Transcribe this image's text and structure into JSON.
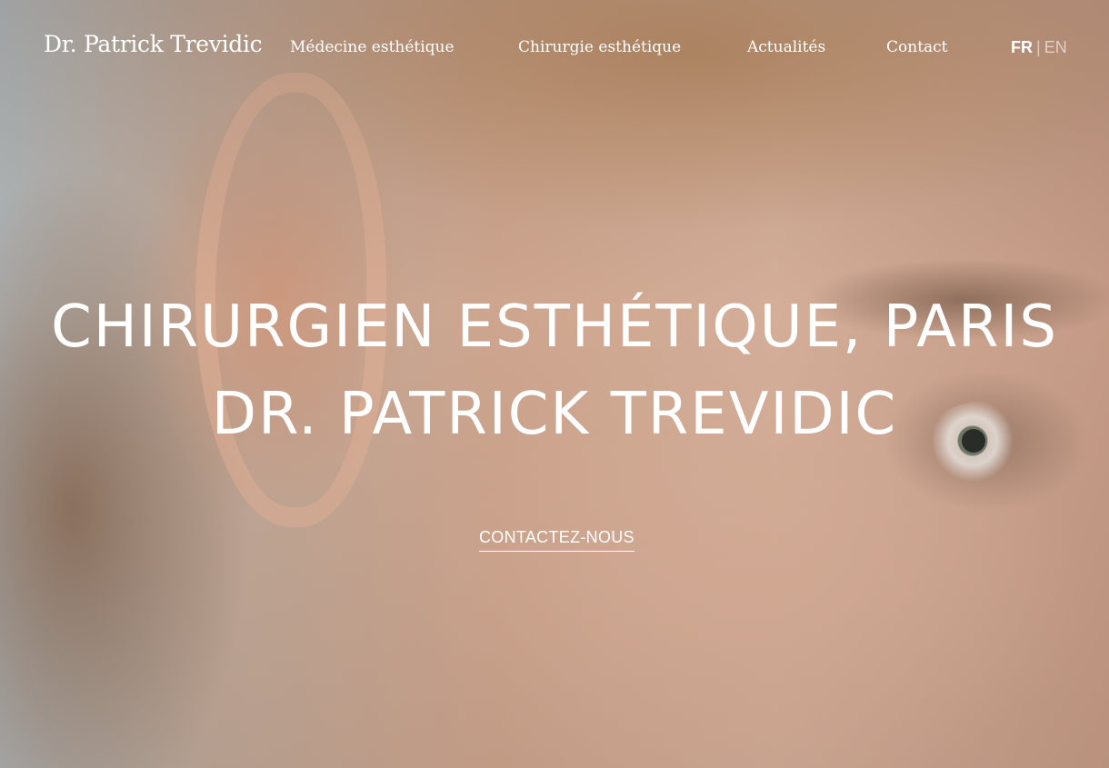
{
  "header": {
    "logo_text": "Dr. Patrick Trevidic",
    "nav": [
      {
        "label": "Médecine esthétique"
      },
      {
        "label": "Chirurgie esthétique"
      },
      {
        "label": "Actualités"
      },
      {
        "label": "Contact"
      }
    ],
    "languages": {
      "active": "FR",
      "separator": "|",
      "other": "EN"
    }
  },
  "hero": {
    "title_line_1": "CHIRURGIEN ESTHÉTIQUE, PARIS",
    "title_line_2": "DR. PATRICK TREVIDIC",
    "cta_label": "CONTACTEZ-NOUS",
    "background_image": "close-up portrait of a woman's ear and eye"
  },
  "colors": {
    "text": "#ffffff",
    "skin_tone": "#ddb6a0"
  }
}
